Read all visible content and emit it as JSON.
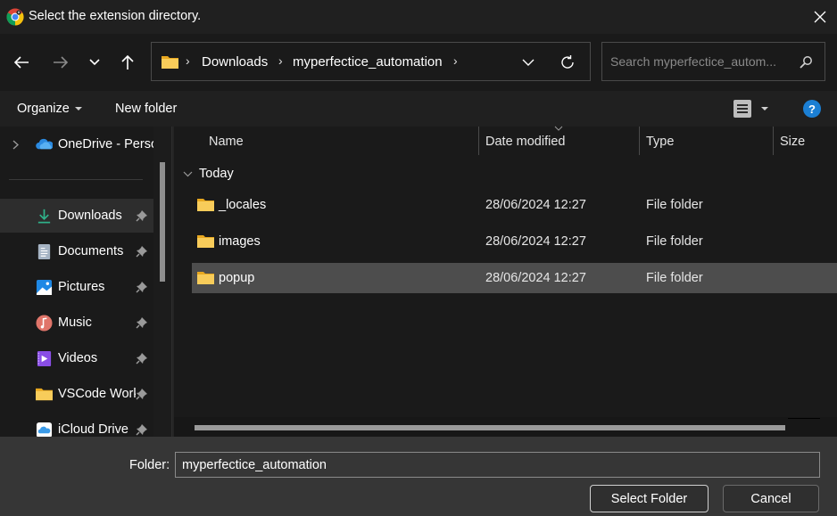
{
  "window": {
    "title": "Select the extension directory.",
    "app_icon": "chrome-icon",
    "close_icon": "close-icon"
  },
  "navigation": {
    "back_icon": "arrow-left-icon",
    "forward_icon": "arrow-right-icon",
    "recent_icon": "chevron-down-icon",
    "up_icon": "arrow-up-icon",
    "breadcrumb": [
      "Downloads",
      "myperfectice_automation"
    ],
    "refresh_icon": "refresh-icon",
    "search_placeholder": "Search myperfectice_autom..."
  },
  "commandbar": {
    "organize_label": "Organize",
    "new_folder_label": "New folder",
    "view_icon": "details-view-icon",
    "help_label": "?"
  },
  "sidebar": {
    "items": [
      {
        "label": "OneDrive - Personal",
        "icon": "onedrive-icon",
        "pinned": false,
        "expandable": true
      },
      {
        "label": "Downloads",
        "icon": "download-icon",
        "pinned": true,
        "selected": true
      },
      {
        "label": "Documents",
        "icon": "documents-icon",
        "pinned": true
      },
      {
        "label": "Pictures",
        "icon": "pictures-icon",
        "pinned": true
      },
      {
        "label": "Music",
        "icon": "music-icon",
        "pinned": true
      },
      {
        "label": "Videos",
        "icon": "videos-icon",
        "pinned": true
      },
      {
        "label": "VSCode Workspace",
        "icon": "folder-icon",
        "pinned": true
      },
      {
        "label": "iCloud Drive",
        "icon": "icloud-icon",
        "pinned": true
      }
    ]
  },
  "filelist": {
    "columns": [
      "Name",
      "Date modified",
      "Type",
      "Size"
    ],
    "sorted_by": "Date modified",
    "group_label": "Today",
    "rows": [
      {
        "name": "_locales",
        "date": "28/06/2024 12:27",
        "type": "File folder",
        "size": ""
      },
      {
        "name": "images",
        "date": "28/06/2024 12:27",
        "type": "File folder",
        "size": ""
      },
      {
        "name": "popup",
        "date": "28/06/2024 12:27",
        "type": "File folder",
        "size": "",
        "selected": true
      }
    ]
  },
  "footer": {
    "folder_label": "Folder:",
    "folder_value": "myperfectice_automation",
    "select_button": "Select Folder",
    "cancel_button": "Cancel"
  },
  "colors": {
    "accent": "#1b7fd4",
    "folder": "#f5c242",
    "download_green": "#2fb28a"
  }
}
